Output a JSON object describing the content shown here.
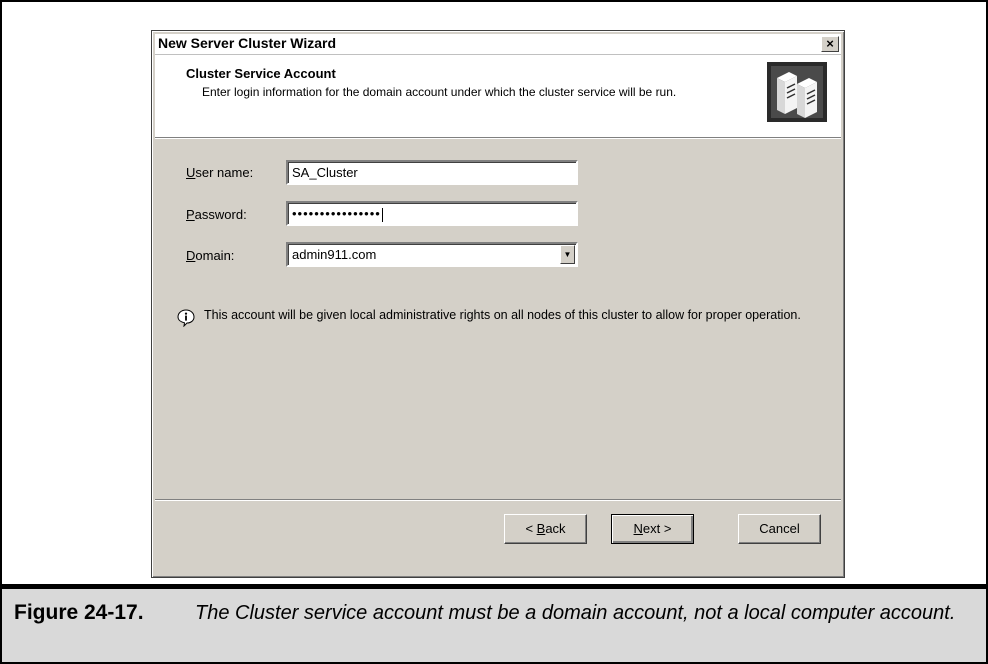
{
  "dialog": {
    "title": "New Server Cluster Wizard",
    "close_glyph": "×",
    "step_title": "Cluster Service Account",
    "step_description": "Enter login information for the domain account under which the cluster service will be run.",
    "header_icon": "server-cluster-icon"
  },
  "form": {
    "username_label_key": "U",
    "username_label_rest": "ser name:",
    "username_value": "SA_Cluster",
    "password_label_key": "P",
    "password_label_rest": "assword:",
    "password_value": "••••••••••••••••",
    "domain_label_key": "D",
    "domain_label_rest": "omain:",
    "domain_value": "admin911.com",
    "dropdown_glyph": "▼"
  },
  "info": {
    "icon": "info-bubble-icon",
    "text": "This account will be given local administrative rights on all nodes of this cluster to allow for proper operation."
  },
  "buttons": {
    "back_prefix": "< ",
    "back_key": "B",
    "back_rest": "ack",
    "next_key": "N",
    "next_rest": "ext >",
    "cancel": "Cancel"
  },
  "caption": {
    "label": "Figure 24-17.",
    "text": "The Cluster service account must be a domain account, not a local computer account."
  }
}
